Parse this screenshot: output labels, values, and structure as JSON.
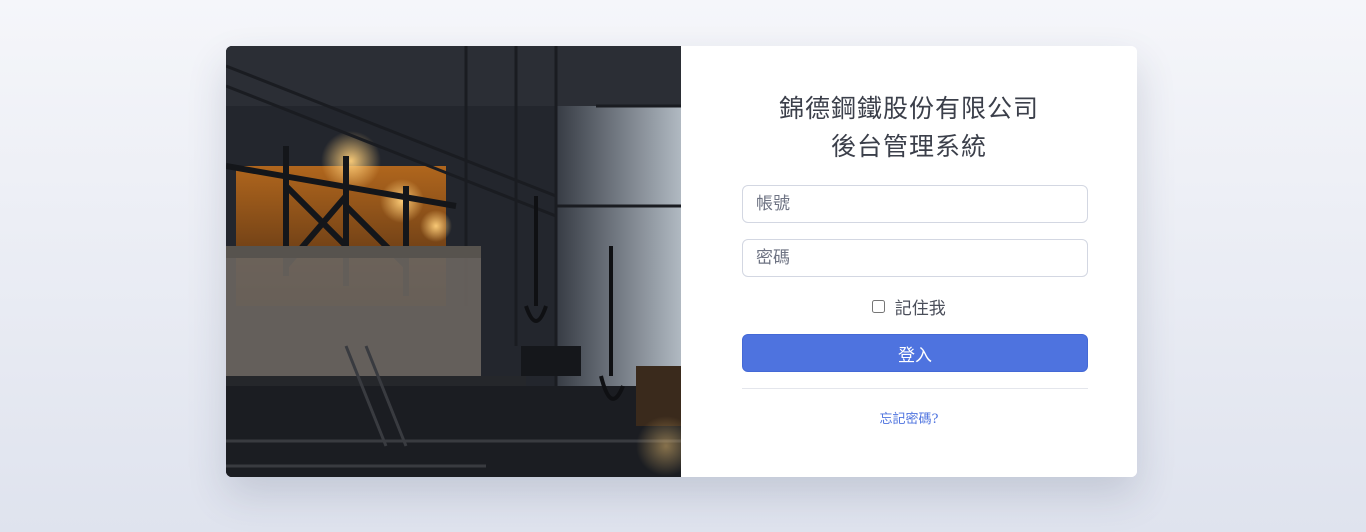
{
  "login": {
    "title_line1": "錦德鋼鐵股份有限公司",
    "title_line2": "後台管理系統",
    "username_placeholder": "帳號",
    "password_placeholder": "密碼",
    "remember_label": "記住我",
    "remember_checked": false,
    "login_button": "登入",
    "forgot_link": "忘記密碼?"
  },
  "colors": {
    "accent": "#4e73df",
    "background": "#eef0f6",
    "card": "#ffffff"
  }
}
